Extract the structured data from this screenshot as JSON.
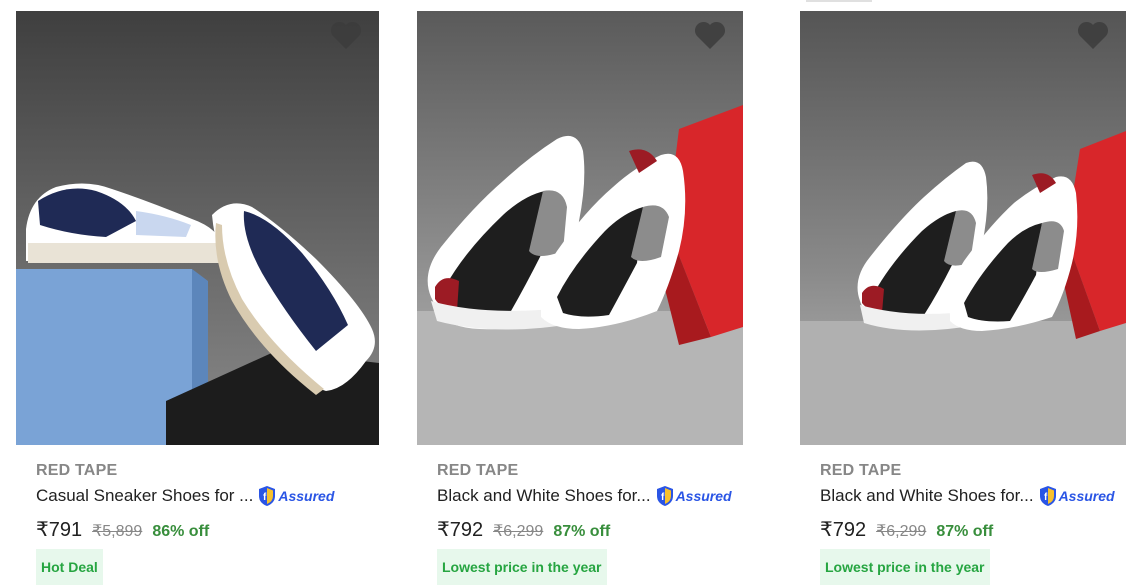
{
  "colors": {
    "brand_text": "#878787",
    "title_text": "#212121",
    "discount_green": "#388e3c",
    "deal_badge_bg": "#e7f8ec",
    "deal_badge_text": "#26a541",
    "assured_blue": "#2a55e5",
    "wishlist_heart": "#3c3c3c"
  },
  "products": [
    {
      "brand": "RED TAPE",
      "title": "Casual Sneaker Shoes for ...",
      "assured_label": "Assured",
      "price": "₹791",
      "mrp": "₹5,899",
      "discount": "86% off",
      "deal": "Hot Deal",
      "wishlist_icon": "heart-icon"
    },
    {
      "brand": "RED TAPE",
      "title": "Black and White Shoes for...",
      "assured_label": "Assured",
      "price": "₹792",
      "mrp": "₹6,299",
      "discount": "87% off",
      "deal": "Lowest price in the year",
      "wishlist_icon": "heart-icon"
    },
    {
      "brand": "RED TAPE",
      "title": "Black and White Shoes for...",
      "assured_label": "Assured",
      "price": "₹792",
      "mrp": "₹6,299",
      "discount": "87% off",
      "deal": "Lowest price in the year",
      "wishlist_icon": "heart-icon"
    }
  ]
}
